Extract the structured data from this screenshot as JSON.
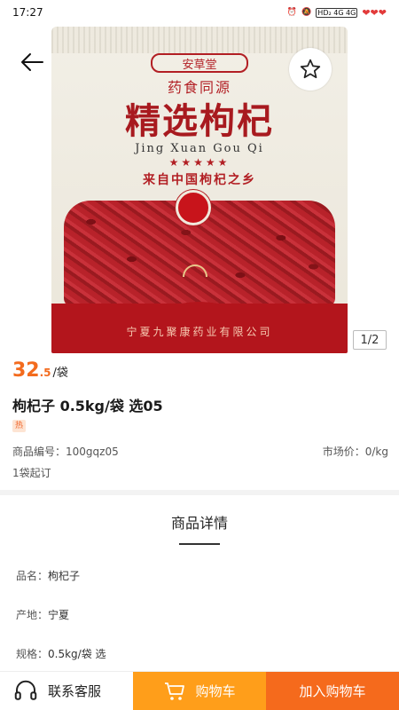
{
  "status_bar": {
    "time": "17:27",
    "indicators": "HD₂  4G  4G",
    "hearts": "❤❤❤"
  },
  "product_image": {
    "brand_seal": "安草堂",
    "slogan": "药食同源",
    "package_title": "精选枸杞",
    "pinyin": "Jing Xuan Gou Qi",
    "stars": "★★★★★",
    "origin": "来自中国枸杞之乡",
    "company": "宁夏九聚康药业有限公司"
  },
  "gallery": {
    "indicator": "1/2"
  },
  "product": {
    "price_int": "32",
    "price_dec": ".5",
    "price_unit": "/袋",
    "title": "枸杞子 0.5kg/袋 选05",
    "tag": "热",
    "code": "商品编号：100gqz05",
    "market_price": "市场价：0/kg",
    "min_order": "1袋起订"
  },
  "details": {
    "heading": "商品详情",
    "attributes": [
      {
        "label": "品名：",
        "value": "枸杞子"
      },
      {
        "label": "产地：",
        "value": "宁夏"
      },
      {
        "label": "规格：",
        "value": "0.5kg/袋 选"
      }
    ]
  },
  "bottom_bar": {
    "service_label": "联系客服",
    "cart_label": "购物车",
    "buy_label": "加入购物车"
  },
  "colors": {
    "accent_orange": "#f36b1e",
    "cart_orange": "#ff9e1a",
    "buy_orange": "#f56a1c"
  },
  "icons": {
    "back": "arrow-left-icon",
    "favorite": "star-outline-icon",
    "service": "headset-icon",
    "cart": "cart-icon"
  }
}
